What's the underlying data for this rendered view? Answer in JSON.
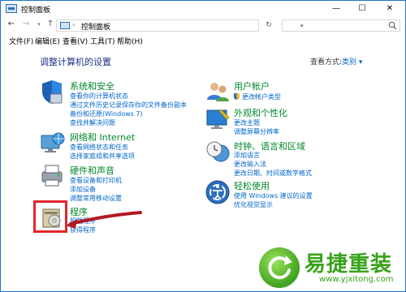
{
  "window": {
    "title": "控制面板"
  },
  "address": {
    "path": "控制面板",
    "separator": "›"
  },
  "search": {
    "placeholder": ""
  },
  "menu": {
    "file": "文件(F)",
    "edit": "编辑(E)",
    "view": "查看(V)",
    "tools": "工具(T)",
    "help": "帮助(H)"
  },
  "main": {
    "heading": "调整计算机的设置",
    "view_by_label": "查看方式:",
    "view_by_value": "类别 ▾"
  },
  "categories": [
    {
      "title": "系统和安全",
      "links": [
        "查看你的计算机状态",
        "通过文件历史记录保存你的文件备份副本",
        "备份和还原(Windows 7)",
        "查找并解决问题"
      ]
    },
    {
      "title": "网络和 Internet",
      "links": [
        "查看网络状态和任务",
        "选择家庭组和共享选项"
      ]
    },
    {
      "title": "硬件和声音",
      "links": [
        "查看设备和打印机",
        "添加设备",
        "调整常用移动设置"
      ]
    },
    {
      "title": "程序",
      "links": [
        "卸载程序",
        "获得程序"
      ]
    },
    {
      "title": "用户帐户",
      "links": [
        "更改帐户类型"
      ]
    },
    {
      "title": "外观和个性化",
      "links": [
        "更改主题",
        "调整屏幕分辨率"
      ]
    },
    {
      "title": "时钟、语言和区域",
      "links": [
        "添加语言",
        "更改输入法",
        "更改日期、时间或数字格式"
      ]
    },
    {
      "title": "轻松使用",
      "links": [
        "使用 Windows 建议的设置",
        "优化视觉显示"
      ]
    }
  ],
  "watermark": {
    "brand": "易捷重装",
    "url": "www.yjxitong.com"
  },
  "colors": {
    "category_title": "#00872b",
    "link": "#0066cc",
    "heading": "#1e3287",
    "highlight": "#e1262b",
    "logo": "#38a319"
  }
}
